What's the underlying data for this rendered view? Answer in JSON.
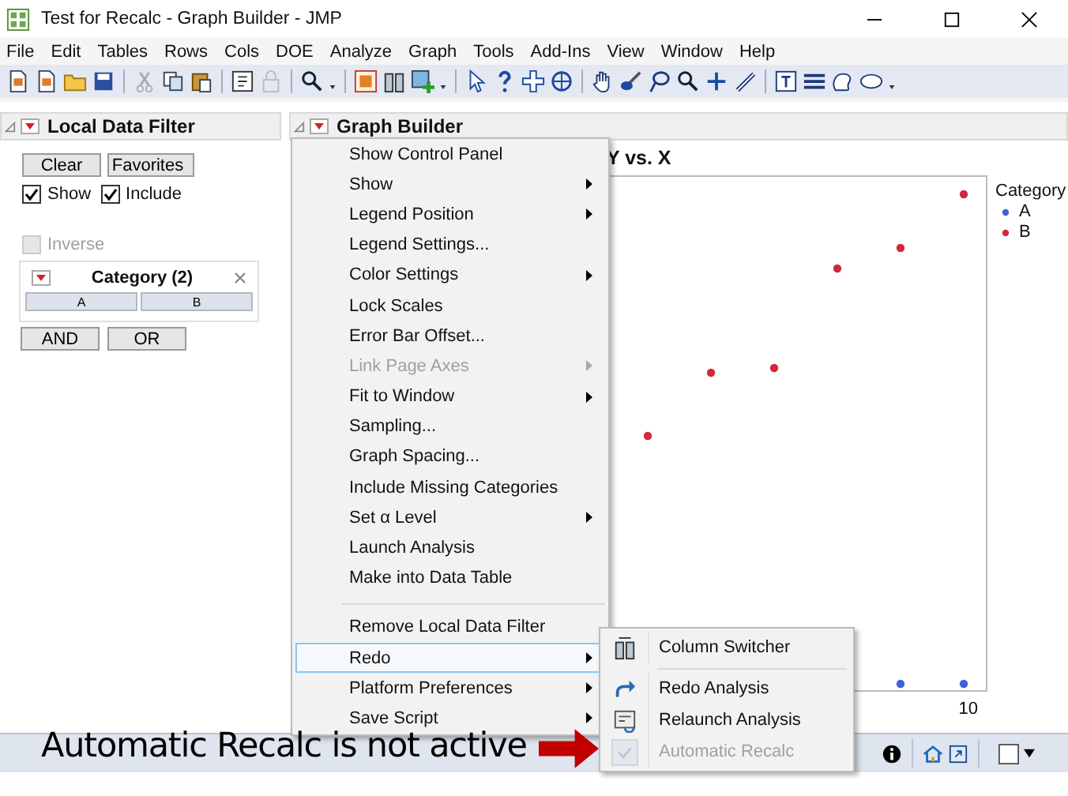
{
  "window": {
    "title": "Test for Recalc - Graph Builder - JMP"
  },
  "menu_bar": [
    "File",
    "Edit",
    "Tables",
    "Rows",
    "Cols",
    "DOE",
    "Analyze",
    "Graph",
    "Tools",
    "Add-Ins",
    "View",
    "Window",
    "Help"
  ],
  "filter": {
    "title": "Local Data Filter",
    "clear": "Clear",
    "favorites": "Favorites",
    "toggles": [
      {
        "label": "Show",
        "checked": true
      },
      {
        "label": "Include",
        "checked": true
      }
    ],
    "inverse": {
      "label": "Inverse",
      "checked": false,
      "disabled": true
    },
    "category": {
      "title": "Category (2)",
      "levels": [
        {
          "label": "A",
          "selected": false
        },
        {
          "label": "B",
          "selected": false
        }
      ]
    },
    "and": "AND",
    "or": "OR"
  },
  "graph": {
    "title": "Graph Builder",
    "chart_title": "Y vs. X",
    "x_tick": "10",
    "legend": {
      "title": "Category",
      "items": [
        {
          "label": "A",
          "color": "#3b63d6"
        },
        {
          "label": "B",
          "color": "#d0293c"
        }
      ]
    }
  },
  "context_menu": {
    "items": [
      {
        "kind": "item",
        "label": "Show Control Panel",
        "submenu": false,
        "disabled": false,
        "selected": false
      },
      {
        "kind": "item",
        "label": "Show",
        "submenu": true,
        "disabled": false,
        "selected": false
      },
      {
        "kind": "item",
        "label": "Legend Position",
        "submenu": true,
        "disabled": false,
        "selected": false
      },
      {
        "kind": "item",
        "label": "Legend Settings...",
        "submenu": false,
        "disabled": false,
        "selected": false
      },
      {
        "kind": "item",
        "label": "Color Settings",
        "submenu": true,
        "disabled": false,
        "selected": false
      },
      {
        "kind": "item",
        "label": "Lock Scales",
        "submenu": false,
        "disabled": false,
        "selected": false
      },
      {
        "kind": "item",
        "label": "Error Bar Offset...",
        "submenu": false,
        "disabled": false,
        "selected": false
      },
      {
        "kind": "item",
        "label": "Link Page Axes",
        "submenu": true,
        "disabled": true,
        "selected": false
      },
      {
        "kind": "item",
        "label": "Fit to Window",
        "submenu": true,
        "disabled": false,
        "selected": false
      },
      {
        "kind": "item",
        "label": "Sampling...",
        "submenu": false,
        "disabled": false,
        "selected": false
      },
      {
        "kind": "item",
        "label": "Graph Spacing...",
        "submenu": false,
        "disabled": false,
        "selected": false
      },
      {
        "kind": "item",
        "label": "Include Missing Categories",
        "submenu": false,
        "disabled": false,
        "selected": false
      },
      {
        "kind": "item",
        "label": "Set α Level",
        "submenu": true,
        "disabled": false,
        "selected": false
      },
      {
        "kind": "item",
        "label": "Launch Analysis",
        "submenu": false,
        "disabled": false,
        "selected": false
      },
      {
        "kind": "item",
        "label": "Make into Data Table",
        "submenu": false,
        "disabled": false,
        "selected": false
      },
      {
        "kind": "separator"
      },
      {
        "kind": "item",
        "label": "Remove Local Data Filter",
        "submenu": false,
        "disabled": false,
        "selected": false
      },
      {
        "kind": "item",
        "label": "Redo",
        "submenu": true,
        "disabled": false,
        "selected": true
      },
      {
        "kind": "item",
        "label": "Platform Preferences",
        "submenu": true,
        "disabled": false,
        "selected": false
      },
      {
        "kind": "item",
        "label": "Save Script",
        "submenu": true,
        "disabled": false,
        "selected": false
      }
    ]
  },
  "submenu": {
    "items": [
      {
        "kind": "item",
        "label": "Column Switcher",
        "checked": false,
        "disabled": false
      },
      {
        "kind": "separator"
      },
      {
        "kind": "item",
        "label": "Redo Analysis",
        "checked": false,
        "disabled": false
      },
      {
        "kind": "item",
        "label": "Relaunch Analysis",
        "checked": false,
        "disabled": false
      },
      {
        "kind": "item",
        "label": "Automatic Recalc",
        "checked": true,
        "disabled": true
      }
    ]
  },
  "status_bar": {
    "checkbox": {
      "checked": false
    }
  },
  "annotation": {
    "text": "Automatic Recalc is not active"
  }
}
